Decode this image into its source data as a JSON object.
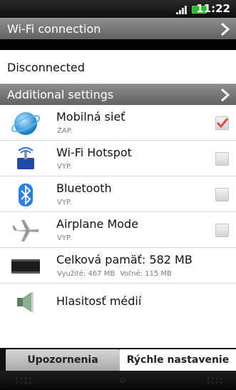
{
  "status_bar": {
    "time": "11:22",
    "icons": [
      "signal-icon",
      "battery-icon"
    ],
    "battery_color": "#2db82d"
  },
  "wifi_section": {
    "header": "Wi-Fi connection",
    "status": "Disconnected"
  },
  "additional_section": {
    "header": "Additional settings",
    "items": [
      {
        "title": "Mobilná sieť",
        "subtitle": "ZAP.",
        "icon": "globe-icon",
        "checkbox": true,
        "checked": true
      },
      {
        "title": "Wi-Fi Hotspot",
        "subtitle": "VYP.",
        "icon": "wifi-hotspot-icon",
        "checkbox": true,
        "checked": false
      },
      {
        "title": "Bluetooth",
        "subtitle": "VYP.",
        "icon": "bluetooth-icon",
        "checkbox": true,
        "checked": false
      },
      {
        "title": "Airplane Mode",
        "subtitle": "VYP.",
        "icon": "airplane-icon",
        "checkbox": true,
        "checked": false
      },
      {
        "title": "Celková pamäť: 582 MB",
        "used": "Využité: 467 MB",
        "free": "Voľné: 115 MB",
        "icon": "memory-chip-icon",
        "checkbox": false
      },
      {
        "title": "Hlasitosť médií",
        "icon": "speaker-icon",
        "checkbox": false
      }
    ]
  },
  "tabs": [
    {
      "label": "Upozornenia",
      "active": false
    },
    {
      "label": "Rýchle nastavenie",
      "active": true
    }
  ],
  "colors": {
    "header_gradient_top": "#8d8d8d",
    "header_gradient_bottom": "#626262",
    "check_red": "#e24c3f"
  }
}
